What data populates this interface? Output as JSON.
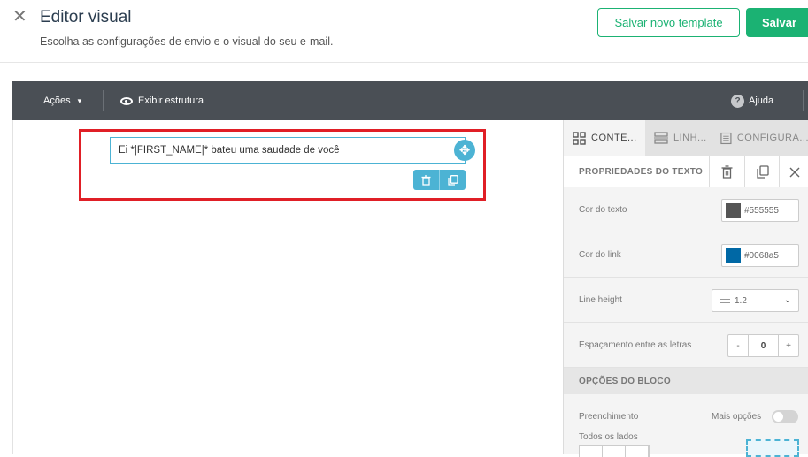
{
  "header": {
    "close_glyph": "✕",
    "title": "Editor visual",
    "subtitle": "Escolha as configurações de envio e o visual do seu e-mail.",
    "save_template_label": "Salvar novo template",
    "save_label": "Salvar"
  },
  "toolbar": {
    "actions_label": "Ações",
    "show_structure_label": "Exibir estrutura",
    "help_label": "Ajuda",
    "help_glyph": "?"
  },
  "canvas": {
    "text_block": "Ei *|FIRST_NAME|* bateu uma saudade de você",
    "move_glyph": "✥"
  },
  "panel": {
    "tabs": [
      {
        "label": "CONTE...",
        "icon": "grid-icon"
      },
      {
        "label": "LINH...",
        "icon": "rows-icon"
      },
      {
        "label": "CONFIGURA...",
        "icon": "document-icon"
      }
    ],
    "text_properties_title": "PROPRIEDADES DO TEXTO",
    "rows": {
      "text_color": {
        "label": "Cor do texto",
        "value": "#555555",
        "swatch": "#555555"
      },
      "link_color": {
        "label": "Cor do link",
        "value": "#0068a5",
        "swatch": "#0068a5"
      },
      "line_height": {
        "label": "Line height",
        "value": "1.2"
      },
      "letter_spacing": {
        "label": "Espaçamento entre as letras",
        "value": "0",
        "minus": "-",
        "plus": "+"
      }
    },
    "block_options_title": "OPÇÕES DO BLOCO",
    "padding_label": "Preenchimento",
    "more_options_label": "Mais opções",
    "all_sides_label": "Todos os lados"
  },
  "colors": {
    "accent_green": "#1bb273",
    "toolbar_bg": "#4a4f55",
    "selection_red": "#e01f26",
    "handle_blue": "#4cb3d4"
  }
}
